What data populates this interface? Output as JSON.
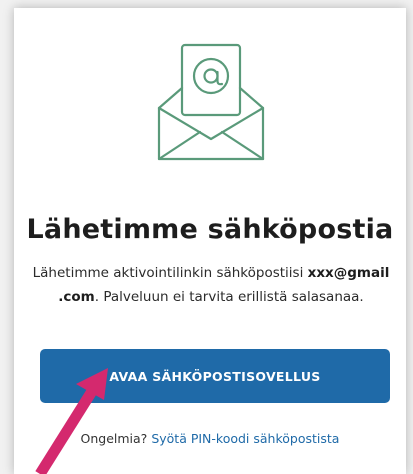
{
  "icons": {
    "envelope": "envelope-at-icon",
    "arrow": "pointer-arrow"
  },
  "colors": {
    "accent": "#1f6aa8",
    "icon_green": "#5a9a7a",
    "arrow": "#d4296e"
  },
  "heading": "Lähetimme sähköpostia",
  "body": {
    "prefix": "Lähetimme aktivointilinkin sähköpostiisi ",
    "email_part1": "xxx@gmail",
    "email_part2": ".com",
    "suffix": ". Palveluun ei tarvita erillistä salasanaa."
  },
  "button": {
    "label": "AVAA SÄHKÖPOSTISOVELLUS"
  },
  "help": {
    "prompt": "Ongelmia?",
    "link": "Syötä PIN-koodi sähköpostista"
  }
}
